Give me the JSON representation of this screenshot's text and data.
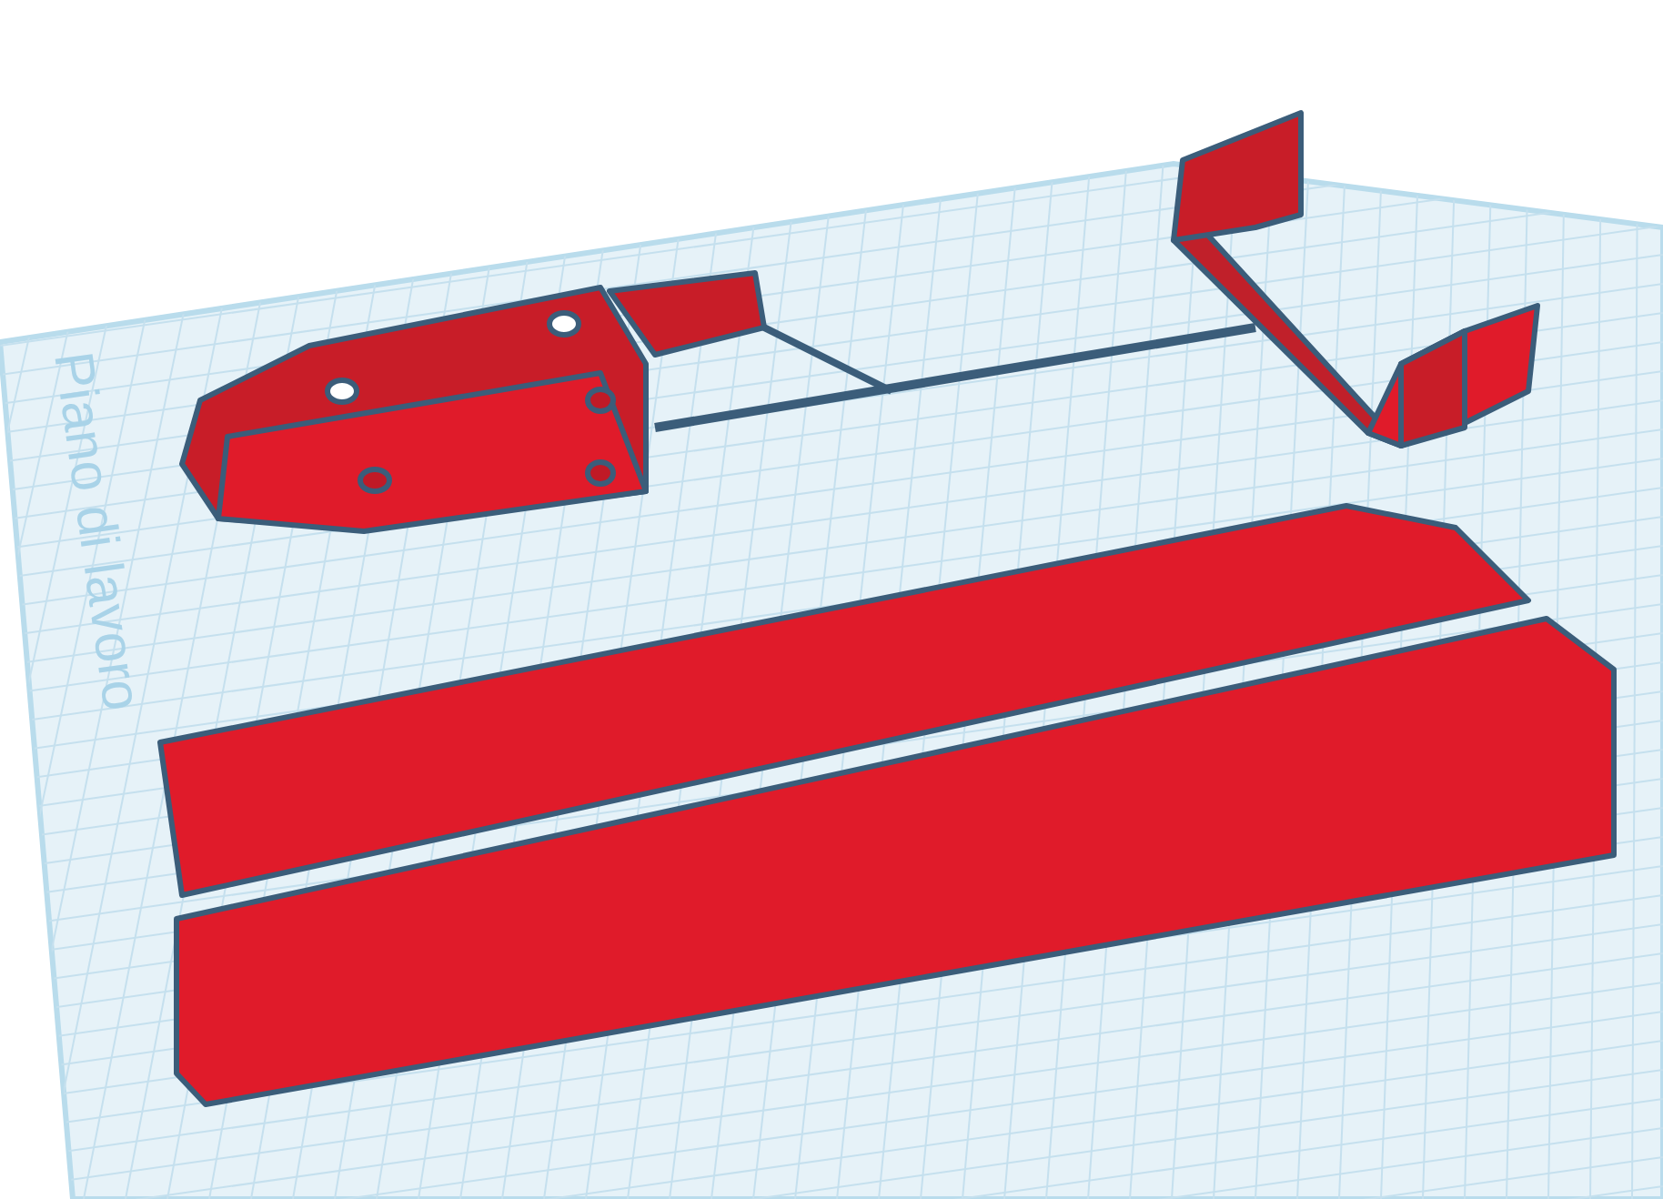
{
  "workplane": {
    "label": "Piano di lavoro"
  }
}
